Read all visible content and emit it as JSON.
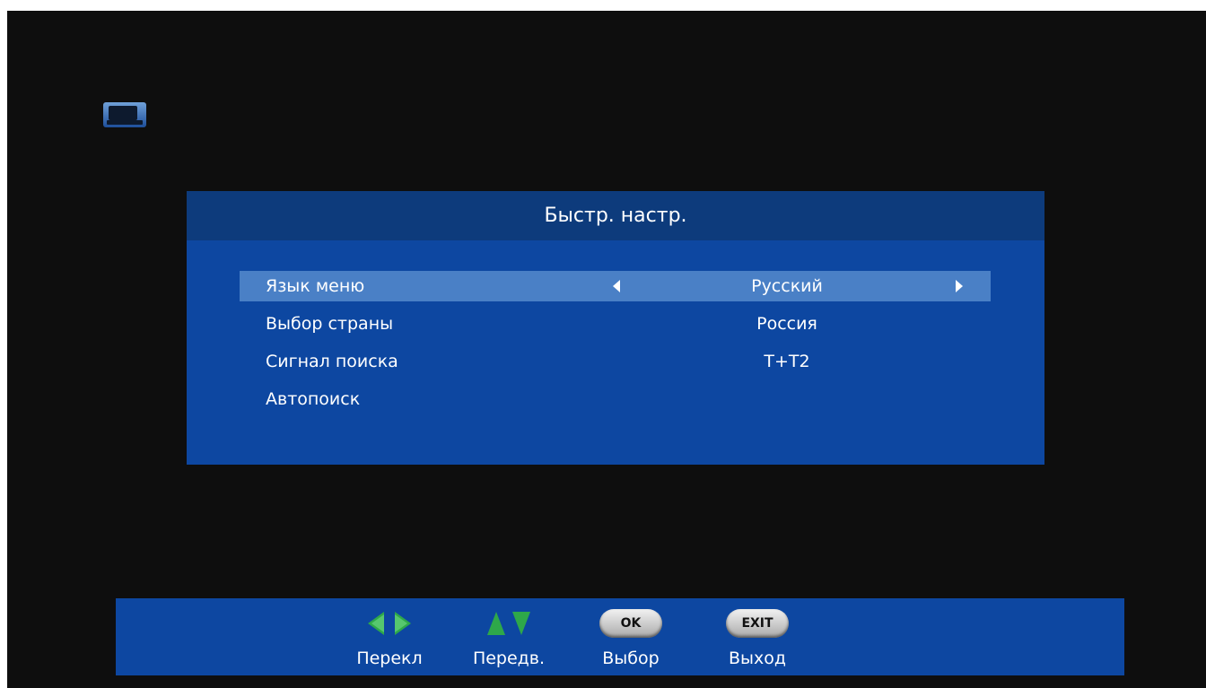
{
  "header": {
    "title": "Быстр. настр."
  },
  "menu": {
    "rows": [
      {
        "label": "Язык меню",
        "value": "Русский",
        "selected": true
      },
      {
        "label": "Выбор страны",
        "value": "Россия",
        "selected": false
      },
      {
        "label": "Сигнал поиска",
        "value": "T+T2",
        "selected": false
      },
      {
        "label": "Автопоиск",
        "value": "",
        "selected": false
      }
    ]
  },
  "footer": {
    "hints": [
      {
        "icon": "left-right-arrows-icon",
        "label": "Перекл"
      },
      {
        "icon": "up-down-arrows-icon",
        "label": "Передв."
      },
      {
        "icon": "ok-button-icon",
        "button_text": "OK",
        "label": "Выбор"
      },
      {
        "icon": "exit-button-icon",
        "button_text": "EXIT",
        "label": "Выход"
      }
    ]
  },
  "colors": {
    "screen_background": "#0e0e0e",
    "panel_background": "#0d47a1",
    "panel_header": "#0d3b7c",
    "selected_row": "#4a80c6",
    "arrow_green": "#2ea84a",
    "text": "#ffffff"
  },
  "icons": {
    "tv": "tv-icon"
  }
}
